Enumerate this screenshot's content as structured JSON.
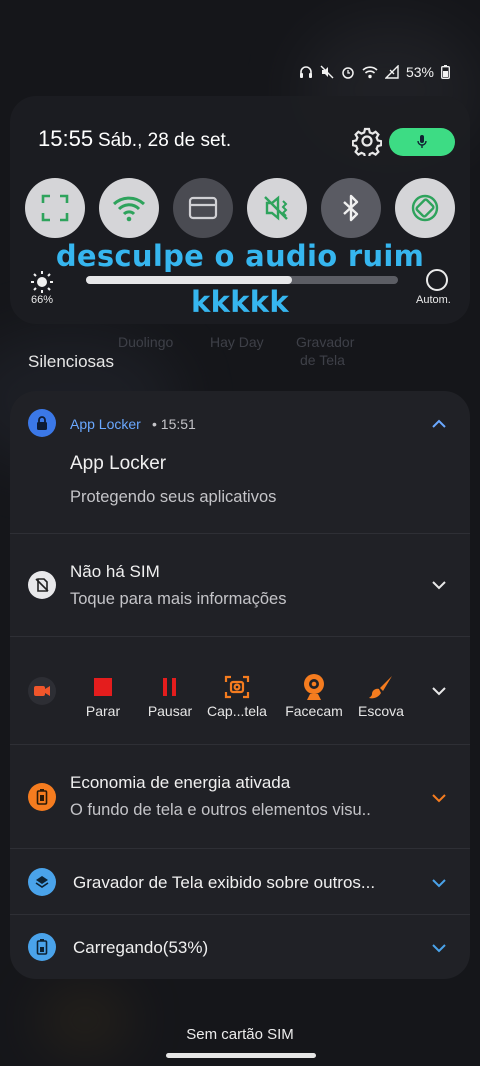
{
  "status": {
    "battery": "53%"
  },
  "quick_settings": {
    "time": "15:55",
    "date": "Sáb., 28 de set.",
    "brightness_pct": "66%",
    "brightness_level": 0.66,
    "auto_label": "Autom.",
    "toggles": [
      {
        "name": "screen-capture",
        "state": "on"
      },
      {
        "name": "wifi",
        "state": "on"
      },
      {
        "name": "card",
        "state": "off"
      },
      {
        "name": "mute",
        "state": "on"
      },
      {
        "name": "bluetooth",
        "state": "off"
      },
      {
        "name": "auto-rotate",
        "state": "on"
      }
    ]
  },
  "overlay": {
    "line1": "desculpe o audio ruim",
    "line2": "kkkkk"
  },
  "background_apps": [
    "Duolingo",
    "Hay Day",
    "Gravador",
    "de Tela"
  ],
  "section_title": "Silenciosas",
  "notifications": {
    "app_locker": {
      "app": "App Locker",
      "time": "• 15:51",
      "title": "App Locker",
      "text": "Protegendo seus aplicativos"
    },
    "no_sim": {
      "title": "Não há SIM",
      "text": "Toque para mais informações"
    },
    "recorder_actions": [
      "Parar",
      "Pausar",
      "Cap...tela",
      "Facecam",
      "Escova"
    ],
    "power_saving": {
      "title": "Economia de energia ativada",
      "text": "O fundo de tela e outros elementos visu.."
    },
    "screen_recorder": {
      "title": "Gravador de Tela exibido sobre outros..."
    },
    "charging": {
      "title": "Carregando(53%)"
    }
  },
  "footer": {
    "text": "Sem cartão SIM"
  },
  "colors": {
    "accent_blue": "#6aa8ff",
    "green": "#3ddc84",
    "orange": "#f57c1f",
    "overlay": "#36b6ef"
  }
}
